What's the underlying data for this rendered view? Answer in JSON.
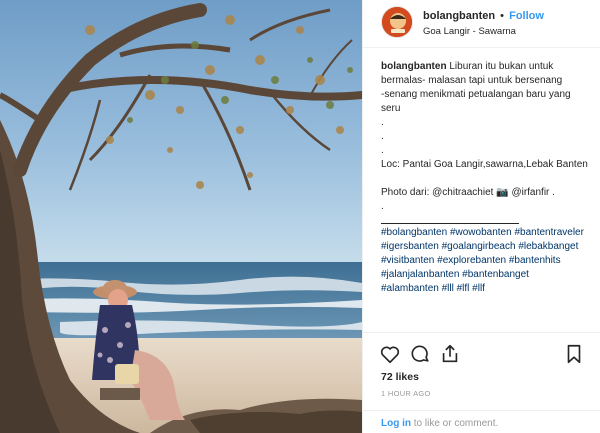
{
  "header": {
    "username": "bolangbanten",
    "separator": "•",
    "follow_label": "Follow",
    "location": "Goa Langir - Sawarna",
    "avatar_icon": "bolangbanten-logo-avatar"
  },
  "caption": {
    "username": "bolangbanten",
    "line1": "Liburan itu bukan untuk",
    "line2": "bermalas- malasan tapi untuk bersenang",
    "line3": "-senang menikmati petualangan baru yang",
    "line4": "seru",
    "dot1": ".",
    "dot2": ".",
    "dot3": ".",
    "location_line": "Loc: Pantai Goa Langir,sawarna,Lebak Banten",
    "photo_credit_prefix": "Photo dari: @chitraachiet",
    "camera_emoji": "📷",
    "photo_credit_suffix": "@irfanfir .",
    "dot4": ".",
    "hashtags": [
      "#bolangbanten #wowobanten #bantentraveler",
      "#igersbanten #goalangirbeach #lebakbanget",
      "#visitbanten #explorebanten #bantenhits",
      "#jalanjalanbanten #bantenbanget",
      "#alambanten #lll #lfl #llf"
    ]
  },
  "actions": {
    "icons": [
      "heart-icon",
      "comment-icon",
      "share-icon",
      "bookmark-icon"
    ],
    "likes": "72 likes",
    "time": "1 HOUR AGO"
  },
  "comment": {
    "login_label": "Log in",
    "rest": "to like or comment."
  },
  "colors": {
    "link_blue": "#3897f0",
    "hashtag": "#003569",
    "muted": "#999999",
    "sky": "#7aa6cf",
    "sea": "#4a7b9e",
    "avatar_bg": "#d24a1e"
  }
}
